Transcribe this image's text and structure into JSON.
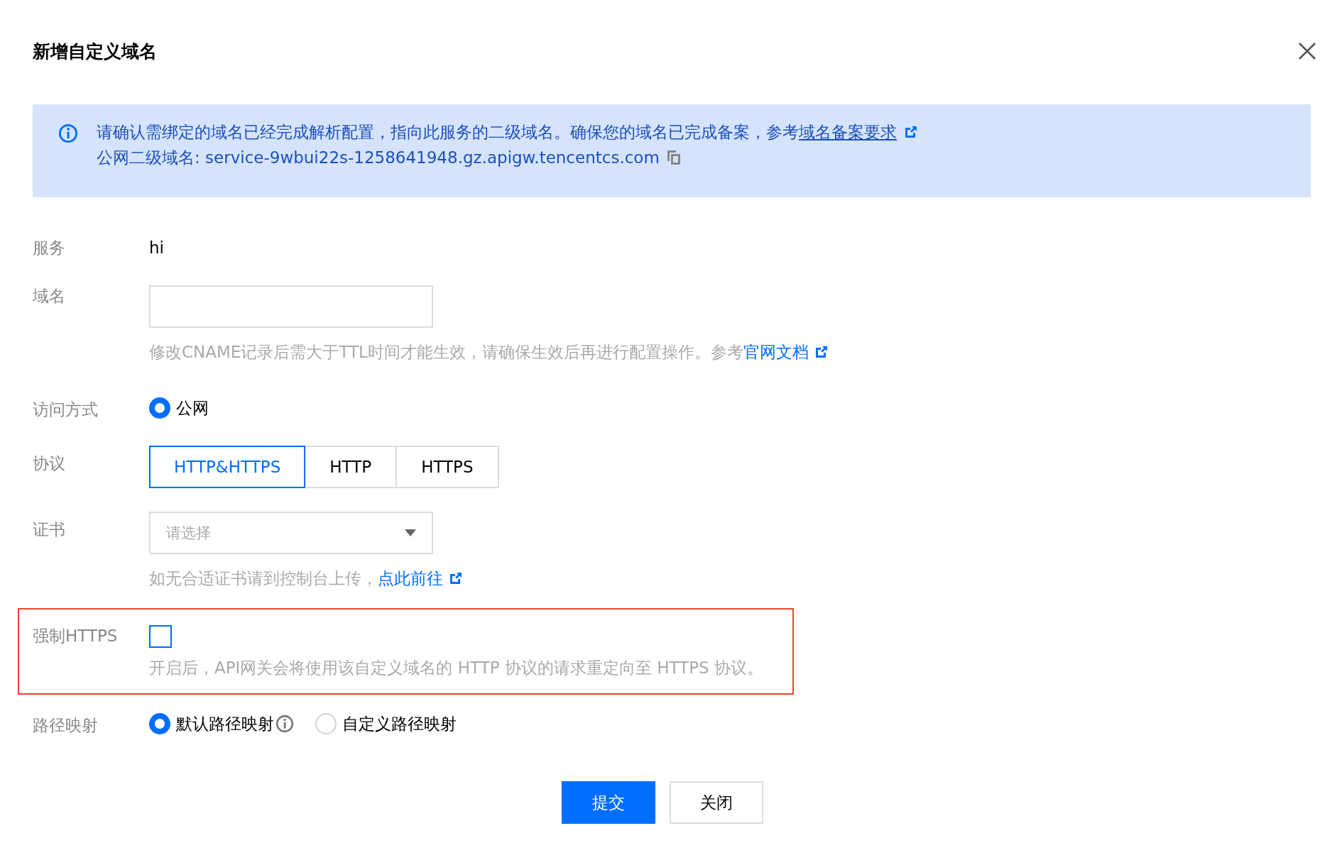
{
  "dialog": {
    "title": "新增自定义域名"
  },
  "notice": {
    "text": "请确认需绑定的域名已经完成解析配置，指向此服务的二级域名。确保您的域名已完成备案，参考",
    "link": "域名备案要求",
    "domain_line": "公网二级域名: service-9wbui22s-1258641948.gz.apigw.tencentcs.com"
  },
  "fields": [
    {
      "kind": "text",
      "label": "服务",
      "value": "hi"
    },
    {
      "kind": "input",
      "label": "域名",
      "hint": "修改CNAME记录后需大于TTL时间才能生效，请确保生效后再进行配置操作。参考",
      "hint_link": "官网文档"
    },
    {
      "kind": "radio",
      "label": "访问方式",
      "options": [
        {
          "label": "公网",
          "selected": true,
          "info": false
        }
      ]
    },
    {
      "kind": "segmented",
      "label": "协议",
      "options": [
        {
          "label": "HTTP&HTTPS",
          "selected": true
        },
        {
          "label": "HTTP",
          "selected": false
        },
        {
          "label": "HTTPS",
          "selected": false
        }
      ]
    },
    {
      "kind": "select",
      "label": "证书",
      "placeholder": "请选择",
      "hint": "如无合适证书请到控制台上传，",
      "hint_link": "点此前往"
    },
    {
      "kind": "checkbox",
      "label": "强制HTTPS",
      "checked": false,
      "highlighted": true,
      "hint": "开启后，API网关会将使用该自定义域名的 HTTP 协议的请求重定向至 HTTPS 协议。"
    },
    {
      "kind": "radio",
      "label": "路径映射",
      "options": [
        {
          "label": "默认路径映射",
          "selected": true,
          "info": true
        },
        {
          "label": "自定义路径映射",
          "selected": false,
          "info": false
        }
      ]
    }
  ],
  "buttons": [
    {
      "label": "提交",
      "primary": true
    },
    {
      "label": "关闭",
      "primary": false
    }
  ]
}
